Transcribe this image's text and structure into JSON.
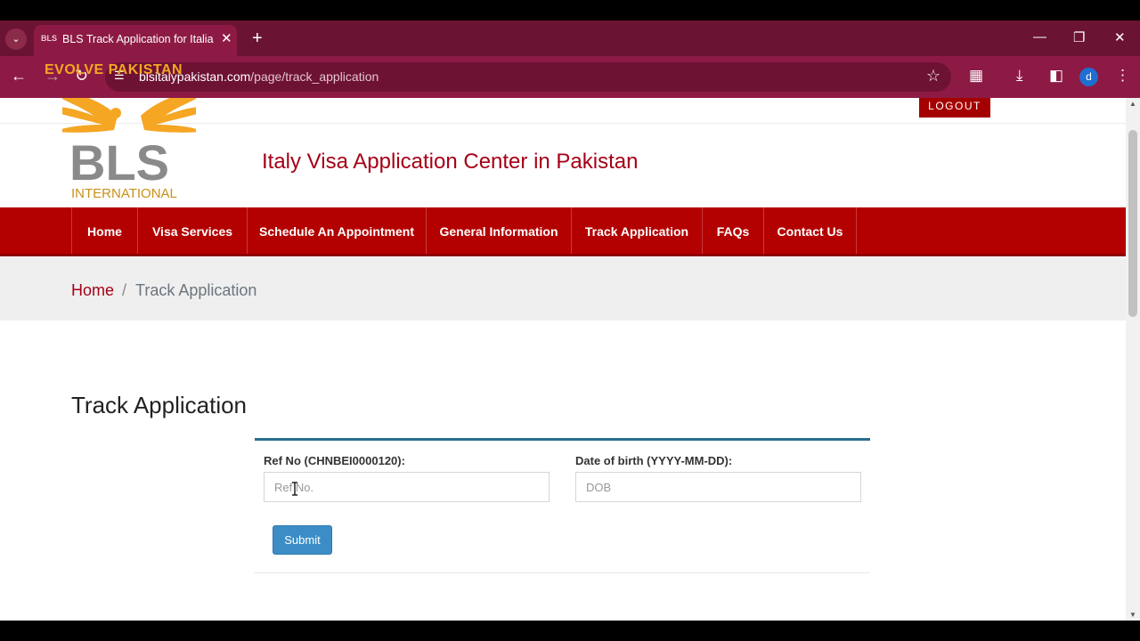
{
  "browser": {
    "tab_title": "BLS Track Application for Italian",
    "tab_favicon": "BLS",
    "new_tab": "+",
    "url_host": "blsitalypakistan.com",
    "url_path": "/page/track_application",
    "profile_initial": "d",
    "accent_color": "#8d1a45"
  },
  "header": {
    "logout_label": "LOGOUT",
    "site_title": "Italy Visa Application Center in Pakistan",
    "logo_text": "BLS",
    "logo_subtext": "INTERNATIONAL"
  },
  "watermark": "EVOLVE PAKISTAN",
  "nav": {
    "items": [
      {
        "label": "Home"
      },
      {
        "label": "Visa Services"
      },
      {
        "label": "Schedule An Appointment"
      },
      {
        "label": "General Information"
      },
      {
        "label": "Track Application"
      },
      {
        "label": "FAQs"
      },
      {
        "label": "Contact Us"
      }
    ],
    "color": "#b30000"
  },
  "breadcrumb": {
    "home": "Home",
    "separator": "/",
    "current": "Track Application"
  },
  "main": {
    "heading": "Track Application",
    "form": {
      "ref_label": "Ref No (CHNBEI0000120):",
      "ref_placeholder": "Ref No.",
      "ref_value": "",
      "dob_label": "Date of birth (YYYY-MM-DD):",
      "dob_placeholder": "DOB",
      "dob_value": "",
      "submit_label": "Submit"
    }
  }
}
